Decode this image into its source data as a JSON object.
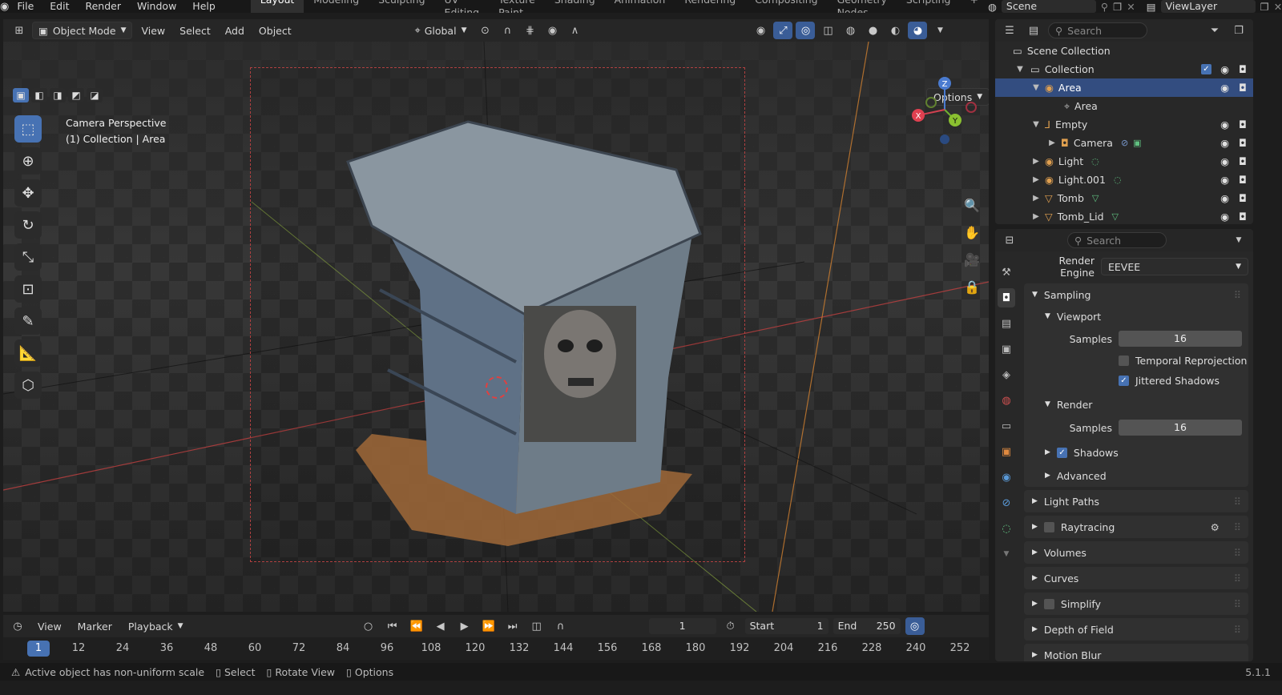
{
  "topbar": {
    "menus": [
      "File",
      "Edit",
      "Render",
      "Window",
      "Help"
    ],
    "workspaces": [
      "Layout",
      "Modeling",
      "Sculpting",
      "UV Editing",
      "Texture Paint",
      "Shading",
      "Animation",
      "Rendering",
      "Compositing",
      "Geometry Nodes",
      "Scripting"
    ],
    "active_workspace": "Layout",
    "add_tab": "+",
    "scene": "Scene",
    "view_layer": "ViewLayer"
  },
  "viewport_header": {
    "mode": "Object Mode",
    "menus": [
      "View",
      "Select",
      "Add",
      "Object"
    ],
    "transform_orientation": "Global"
  },
  "viewport": {
    "info_line1": "Camera Perspective",
    "info_line2": "(1) Collection | Area",
    "options": "Options",
    "axes": [
      "Z",
      "Y",
      "X"
    ]
  },
  "outliner": {
    "search_placeholder": "Search",
    "scene_collection": "Scene Collection",
    "collection": "Collection",
    "rows": [
      {
        "name": "Area",
        "selected": true
      },
      {
        "name": "Area",
        "child": true
      },
      {
        "name": "Empty"
      },
      {
        "name": "Camera"
      },
      {
        "name": "Light"
      },
      {
        "name": "Light.001"
      },
      {
        "name": "Tomb"
      },
      {
        "name": "Tomb_Lid"
      }
    ]
  },
  "properties": {
    "search_placeholder": "Search",
    "render_engine_label": "Render Engine",
    "render_engine": "EEVEE",
    "sampling": "Sampling",
    "viewport": "Viewport",
    "samples_label": "Samples",
    "viewport_samples": "16",
    "temporal_reprojection": "Temporal Reprojection",
    "jittered_shadows": "Jittered Shadows",
    "render": "Render",
    "render_samples": "16",
    "shadows": "Shadows",
    "advanced": "Advanced",
    "panels": [
      "Light Paths",
      "Raytracing",
      "Volumes",
      "Curves",
      "Simplify",
      "Depth of Field"
    ],
    "partial_panel": "Motion Blur"
  },
  "timeline": {
    "menus": [
      "View",
      "Marker",
      "Playback"
    ],
    "current_frame": "1",
    "start_label": "Start",
    "start": "1",
    "end_label": "End",
    "end": "250",
    "ticks": [
      "12",
      "24",
      "36",
      "48",
      "60",
      "72",
      "84",
      "96",
      "108",
      "120",
      "132",
      "144",
      "156",
      "168",
      "180",
      "192",
      "204",
      "216",
      "228",
      "240",
      "252"
    ]
  },
  "statusbar": {
    "warning": "Active object has non-uniform scale",
    "select": "Select",
    "rotate": "Rotate View",
    "options": "Options",
    "version": "5.1.1"
  }
}
